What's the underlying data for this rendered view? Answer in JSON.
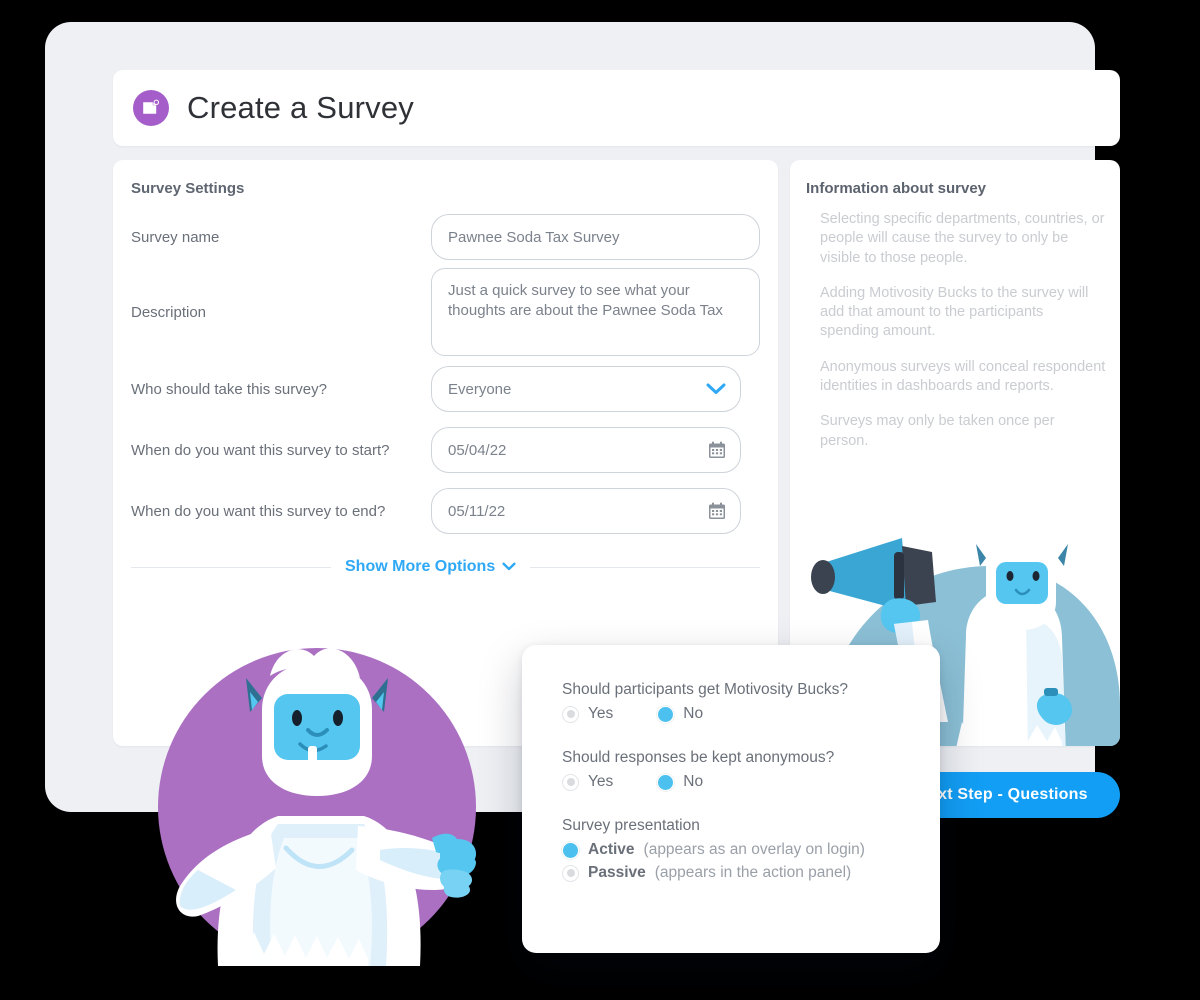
{
  "header": {
    "title": "Create a Survey",
    "icon": "survey-document-icon",
    "badge_color": "#a55ec9"
  },
  "settings": {
    "section_title": "Survey Settings",
    "fields": [
      {
        "label": "Survey name",
        "value": "Pawnee Soda Tax Survey"
      },
      {
        "label": "Description",
        "value": "Just a quick survey to see what your thoughts are about the Pawnee Soda Tax"
      },
      {
        "label": "Who should take this survey?",
        "value": "Everyone"
      },
      {
        "label": "When do you want this survey to start?",
        "value": "05/04/22"
      },
      {
        "label": "When do you want this survey to end?",
        "value": "05/11/22"
      }
    ],
    "show_more_label": "Show More Options",
    "show_more_icon": "chevron-down-icon",
    "link_color": "#2fa8f5"
  },
  "info": {
    "title": "Information about survey",
    "paragraphs": [
      "Selecting specific departments, countries, or people will cause the survey to only be visible to those people.",
      "Adding Motivosity Bucks to the survey will add that amount to the participants spending amount.",
      "Anonymous surveys will conceal respondent identities in dashboards and reports.",
      "Surveys may only be taken once per person."
    ]
  },
  "actions": {
    "next_step_label": "Next Step - Questions",
    "next_step_color": "#129ef5"
  },
  "popup": {
    "questions": [
      {
        "label": "Should participants get Motivosity Bucks?",
        "options": [
          {
            "text": "Yes",
            "selected": false
          },
          {
            "text": "No",
            "selected": true
          }
        ]
      },
      {
        "label": "Should responses be kept anonymous?",
        "options": [
          {
            "text": "Yes",
            "selected": false
          },
          {
            "text": "No",
            "selected": true
          }
        ]
      }
    ],
    "presentation": {
      "label": "Survey presentation",
      "options": [
        {
          "name": "Active",
          "detail": "(appears as an overlay on login)",
          "selected": true
        },
        {
          "name": "Passive",
          "detail": "(appears in the action panel)",
          "selected": false
        }
      ]
    },
    "selected_radio_color": "#4cc0ef"
  },
  "illustrations": {
    "pointing_yeti": {
      "name": "yeti-pointing-illustration",
      "circle_color": "#ab70c2"
    },
    "megaphone_yeti": {
      "name": "yeti-megaphone-illustration",
      "circle_color": "#8cc0d6"
    }
  }
}
